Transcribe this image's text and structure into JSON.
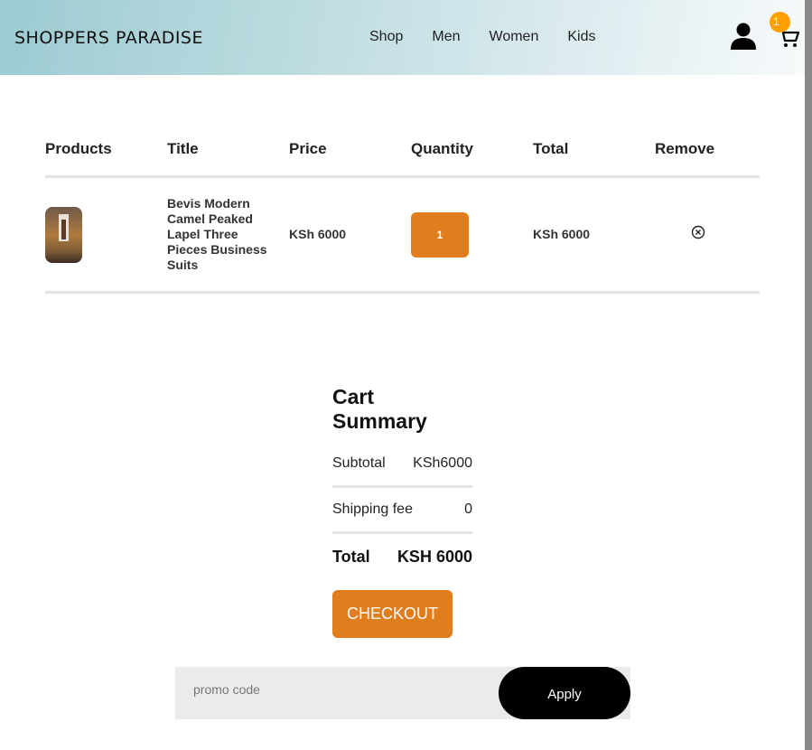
{
  "header": {
    "brand": "SHOPPERS PARADISE",
    "nav": [
      "Shop",
      "Men",
      "Women",
      "Kids"
    ],
    "cart_count": "1"
  },
  "table": {
    "headers": [
      "Products",
      "Title",
      "Price",
      "Quantity",
      "Total",
      "Remove"
    ],
    "rows": [
      {
        "title": "Bevis Modern Camel Peaked Lapel Three Pieces Business Suits",
        "price": "KSh 6000",
        "quantity": "1",
        "total": "KSh 6000"
      }
    ]
  },
  "summary": {
    "title": "Cart Summary",
    "subtotal_label": "Subtotal",
    "subtotal_value": "KSh6000",
    "shipping_label": "Shipping fee",
    "shipping_value": "0",
    "total_label": "Total",
    "total_value": "KSH 6000"
  },
  "checkout_label": "CHECKOUT",
  "promo": {
    "placeholder": "promo code",
    "apply_label": "Apply"
  },
  "colors": {
    "accent": "#e07d1c",
    "badge": "#ffa000",
    "header_gradient_start": "#9ccbd2"
  }
}
